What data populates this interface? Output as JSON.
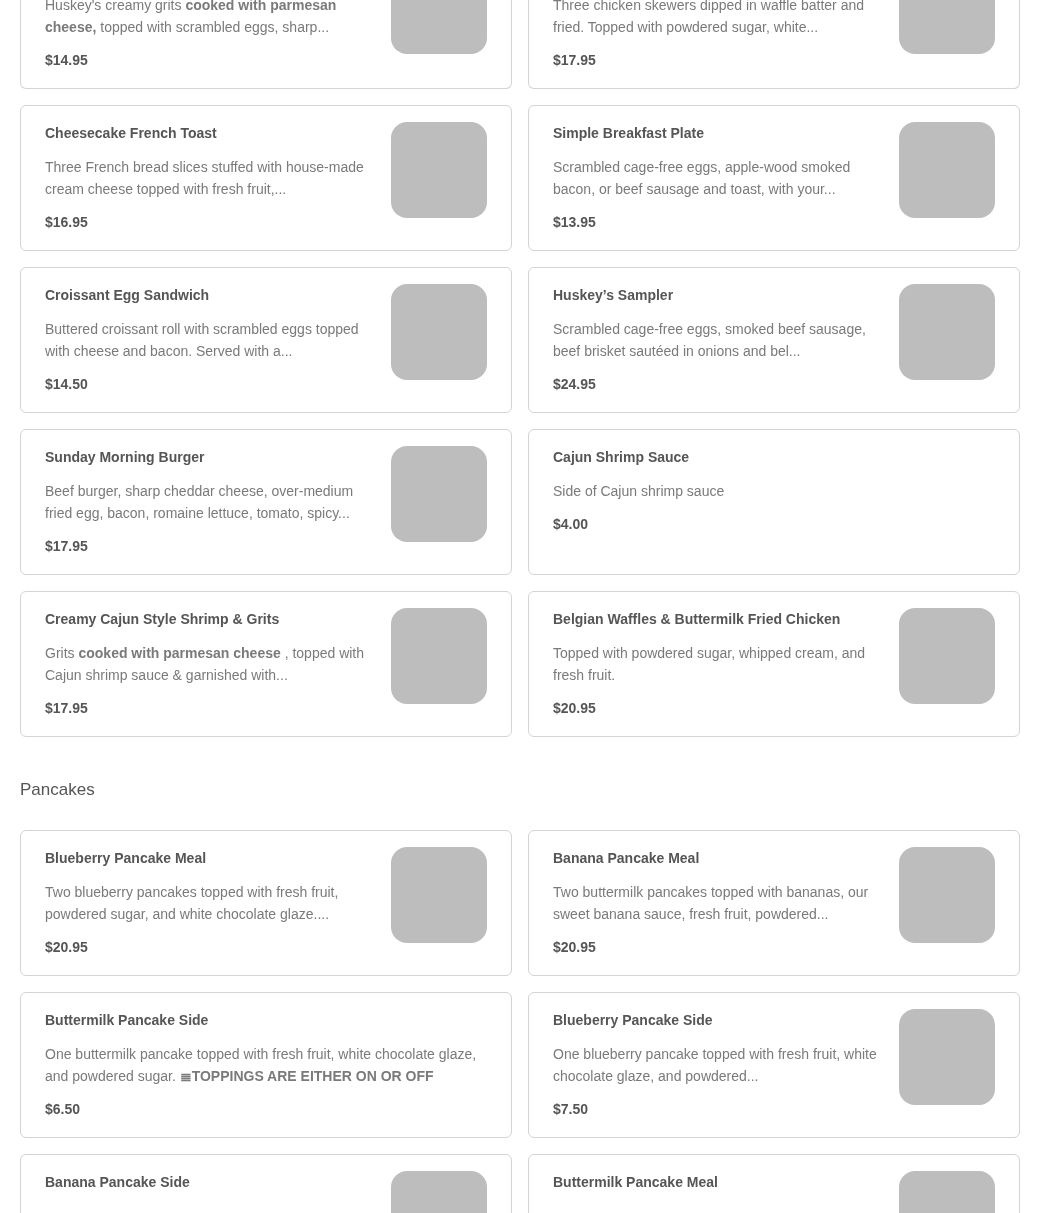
{
  "sections": [
    {
      "items": [
        {
          "description": "Huskey's creamy grits **cooked with parmesan cheese,** topped with scrambled eggs, sharp...",
          "price": "$14.95",
          "has_image": true
        },
        {
          "description": "Three chicken skewers dipped in waffle batter and fried. Topped with powdered sugar, white...",
          "price": "$17.95",
          "has_image": true
        },
        {
          "name": "Cheesecake French Toast",
          "description": "Three French bread slices stuffed with house-made cream cheese topped with fresh fruit,...",
          "price": "$16.95",
          "has_image": true
        },
        {
          "name": "Simple Breakfast Plate",
          "description": "Scrambled cage-free eggs, apple-wood smoked bacon, or beef sausage and toast, with your...",
          "price": "$13.95",
          "has_image": true
        },
        {
          "name": "Croissant Egg Sandwich",
          "description": "Buttered croissant roll with scrambled eggs topped with cheese and bacon. Served with a...",
          "price": "$14.50",
          "has_image": true
        },
        {
          "name": "Huskey’s Sampler",
          "description": "Scrambled cage-free eggs, smoked beef sausage, beef brisket sautéed in onions and bel...",
          "price": "$24.95",
          "has_image": true
        },
        {
          "name": "Sunday Morning Burger",
          "description": "Beef burger, sharp cheddar cheese, over-medium fried egg, bacon, romaine lettuce, tomato, spicy...",
          "price": "$17.95",
          "has_image": true
        },
        {
          "name": "Cajun Shrimp Sauce",
          "description": "Side of Cajun shrimp sauce",
          "price": "$4.00",
          "has_image": false
        },
        {
          "name": "Creamy Cajun Style Shrimp & Grits",
          "description": "Grits **cooked with parmesan cheese** , topped with Cajun shrimp sauce & garnished with...",
          "price": "$17.95",
          "has_image": true
        },
        {
          "name": "Belgian Waffles & Buttermilk Fried Chicken",
          "description": "Topped with powdered sugar, whipped cream, and fresh fruit.",
          "price": "$20.95",
          "has_image": true
        }
      ]
    },
    {
      "title": "Pancakes",
      "items": [
        {
          "name": "Blueberry Pancake Meal",
          "description": "Two blueberry pancakes topped with fresh fruit, powdered sugar, and white chocolate glaze....",
          "price": "$20.95",
          "has_image": true
        },
        {
          "name": "Banana Pancake Meal",
          "description": "Two buttermilk pancakes topped with bananas, our sweet banana sauce, fresh fruit, powdered...",
          "price": "$20.95",
          "has_image": true
        },
        {
          "name": "Buttermilk Pancake Side",
          "description": "One buttermilk pancake topped with fresh fruit, white chocolate glaze, and powdered sugar. **≣TOPPINGS ARE EITHER ON OR OFF**",
          "price": "$6.50",
          "has_image": false
        },
        {
          "name": "Blueberry Pancake Side",
          "description": "One blueberry pancake topped with fresh fruit, white chocolate glaze, and powdered...",
          "price": "$7.50",
          "has_image": true
        },
        {
          "name": "Banana Pancake Side",
          "has_image": true
        },
        {
          "name": "Buttermilk Pancake Meal",
          "has_image": true
        }
      ]
    }
  ]
}
